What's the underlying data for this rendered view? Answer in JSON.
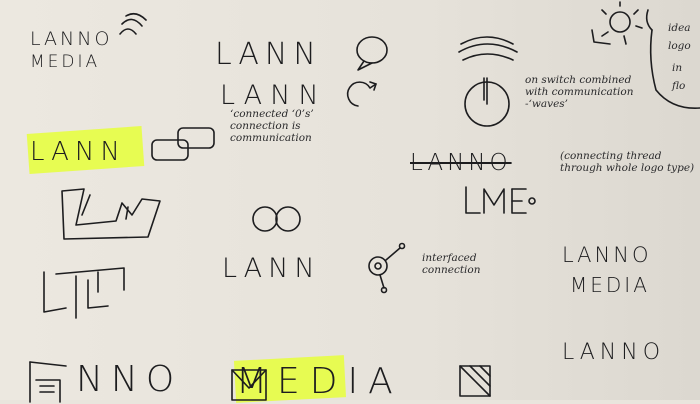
{
  "sketches": {
    "s1_line1": "LANNO",
    "s1_line2": "MEDIA",
    "s2_line1": "LANN",
    "s2_line2": "LANN",
    "s3_note": "on switch combined with communication -‘waves’",
    "s4_logo": "LANN",
    "s5_note": "‘connected ‘0’s’ connection is communication",
    "s6_logo": "LANNO",
    "s6_note": "(connecting thread through whole logo type)",
    "s7_logo": "LANN",
    "s8_note": "interfaced connection",
    "s9_line1": "LANNO",
    "s9_line2": "MEDIA",
    "s10_logo": "LANNO",
    "s11_logo": "NNO",
    "s12_logo": "MEDIA",
    "topright_note_1": "idea",
    "topright_note_2": "logo",
    "topright_note_3": "in",
    "topright_note_4": "flo"
  },
  "colors": {
    "paper": "#e9e5dd",
    "ink": "#1d1d1f",
    "highlighter": "#e6ff3a"
  }
}
